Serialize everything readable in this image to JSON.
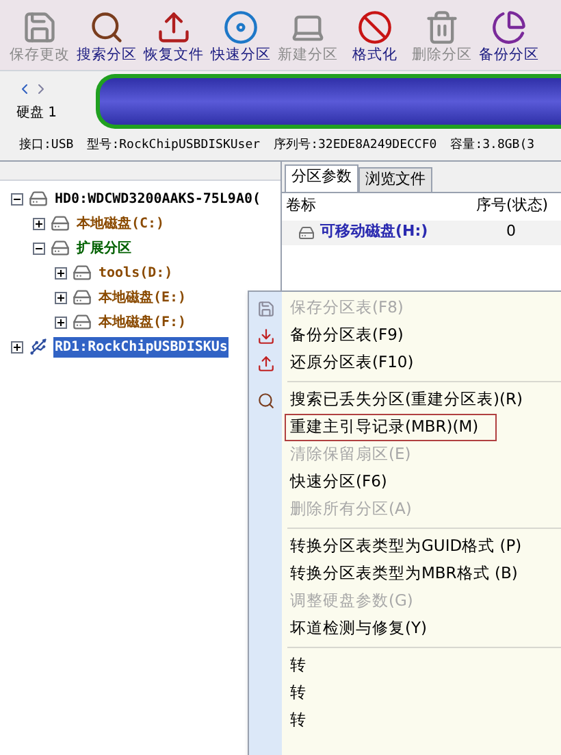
{
  "toolbar": [
    {
      "label": "保存更改",
      "disabled": true
    },
    {
      "label": "搜索分区",
      "disabled": false
    },
    {
      "label": "恢复文件",
      "disabled": false
    },
    {
      "label": "快速分区",
      "disabled": false
    },
    {
      "label": "新建分区",
      "disabled": true
    },
    {
      "label": "格式化",
      "disabled": false
    },
    {
      "label": "删除分区",
      "disabled": true
    },
    {
      "label": "备份分区",
      "disabled": false
    }
  ],
  "disk": {
    "label": "硬盘 1",
    "info": [
      "接口:USB",
      "型号:RockChipUSBDISKUser",
      "序列号:32EDE8A249DECCF0",
      "容量:3.8GB(3"
    ]
  },
  "tree": [
    {
      "label": "HD0:WDCWD3200AAKS-75L9A0(",
      "kind": "disk",
      "expanded": true,
      "selected": false,
      "children": [
        {
          "label": "本地磁盘(C:)",
          "kind": "volume",
          "expanded": false,
          "selected": false
        },
        {
          "label": "扩展分区",
          "kind": "extended",
          "expanded": true,
          "selected": false,
          "children": [
            {
              "label": "tools(D:)",
              "kind": "volume",
              "expanded": false,
              "selected": false
            },
            {
              "label": "本地磁盘(E:)",
              "kind": "volume",
              "expanded": false,
              "selected": false
            },
            {
              "label": "本地磁盘(F:)",
              "kind": "volume",
              "expanded": false,
              "selected": false
            }
          ]
        }
      ]
    },
    {
      "label": "RD1:RockChipUSBDISKUs",
      "kind": "usb",
      "expanded": false,
      "selected": true
    }
  ],
  "tabs": [
    {
      "label": "分区参数",
      "selected": true
    },
    {
      "label": "浏览文件",
      "selected": false
    }
  ],
  "table": {
    "columns": [
      "卷标",
      "序号(状态)"
    ],
    "rows": [
      [
        "可移动磁盘(H:)",
        "0"
      ]
    ]
  },
  "menu": [
    {
      "kind": "item",
      "label": "保存分区表(F8)",
      "disabled": true,
      "highlighted": false
    },
    {
      "kind": "item",
      "label": "备份分区表(F9)",
      "disabled": false,
      "highlighted": false
    },
    {
      "kind": "item",
      "label": "还原分区表(F10)",
      "disabled": false,
      "highlighted": false
    },
    {
      "kind": "separator"
    },
    {
      "kind": "item",
      "label": "搜索已丢失分区(重建分区表)(R)",
      "disabled": false,
      "highlighted": false
    },
    {
      "kind": "item",
      "label": "重建主引导记录(MBR)(M)",
      "disabled": false,
      "highlighted": true
    },
    {
      "kind": "item",
      "label": "清除保留扇区(E)",
      "disabled": true,
      "highlighted": false
    },
    {
      "kind": "item",
      "label": "快速分区(F6)",
      "disabled": false,
      "highlighted": false
    },
    {
      "kind": "item",
      "label": "删除所有分区(A)",
      "disabled": true,
      "highlighted": false
    },
    {
      "kind": "separator"
    },
    {
      "kind": "item",
      "label": "转换分区表类型为GUID格式 (P)",
      "disabled": false,
      "highlighted": false
    },
    {
      "kind": "item",
      "label": "转换分区表类型为MBR格式 (B)",
      "disabled": false,
      "highlighted": false
    },
    {
      "kind": "item",
      "label": "调整硬盘参数(G)",
      "disabled": true,
      "highlighted": false
    },
    {
      "kind": "item",
      "label": "坏道检测与修复(Y)",
      "disabled": false,
      "highlighted": false
    },
    {
      "kind": "separator"
    },
    {
      "kind": "item",
      "label": "转",
      "disabled": false,
      "highlighted": false
    },
    {
      "kind": "item",
      "label": "转",
      "disabled": false,
      "highlighted": false
    },
    {
      "kind": "item",
      "label": "转",
      "disabled": false,
      "highlighted": false
    }
  ]
}
